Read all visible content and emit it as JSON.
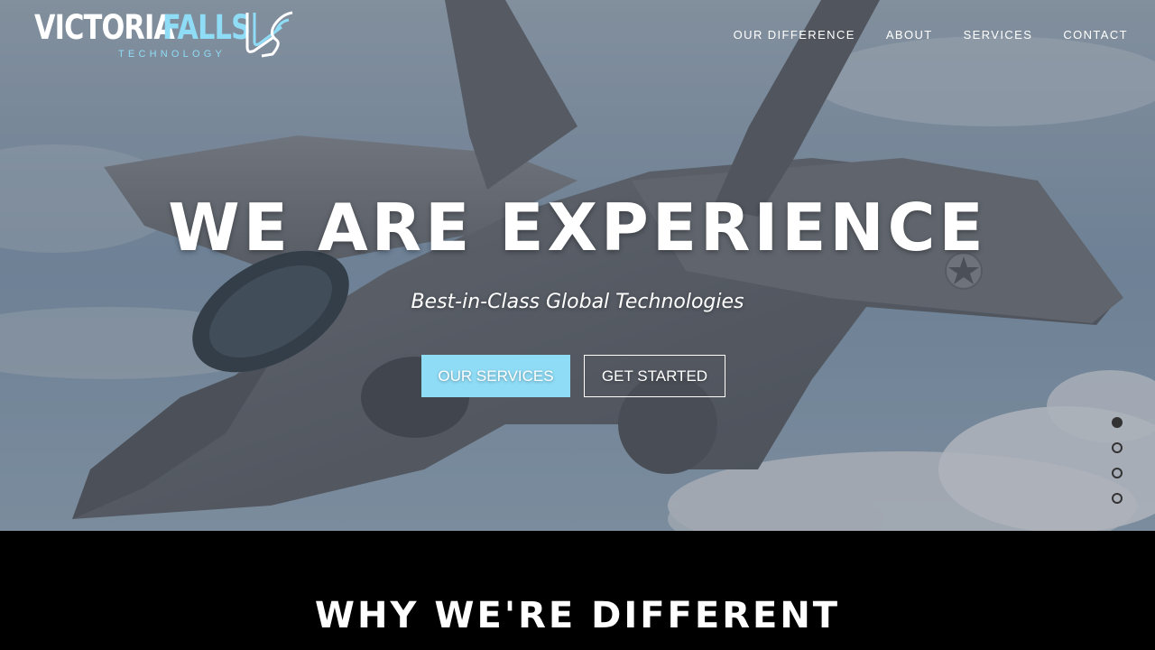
{
  "brand": {
    "word1": "VICTORIA",
    "word2": "FALLS",
    "subtitle": "TECHNOLOGY",
    "accent_color": "#8fdcf6"
  },
  "nav": {
    "items": [
      {
        "label": "OUR DIFFERENCE"
      },
      {
        "label": "ABOUT"
      },
      {
        "label": "SERVICES"
      },
      {
        "label": "CONTACT"
      }
    ]
  },
  "hero": {
    "title": "WE ARE EXPERIENCE",
    "subtitle": "Best-in-Class Global Technologies",
    "primary_button": "OUR SERVICES",
    "secondary_button": "GET STARTED",
    "background_image": "fighter-jet-in-clouds"
  },
  "slider": {
    "slide_count": 4,
    "active_slide": 1
  },
  "section": {
    "title": "WHY WE'RE DIFFERENT"
  }
}
